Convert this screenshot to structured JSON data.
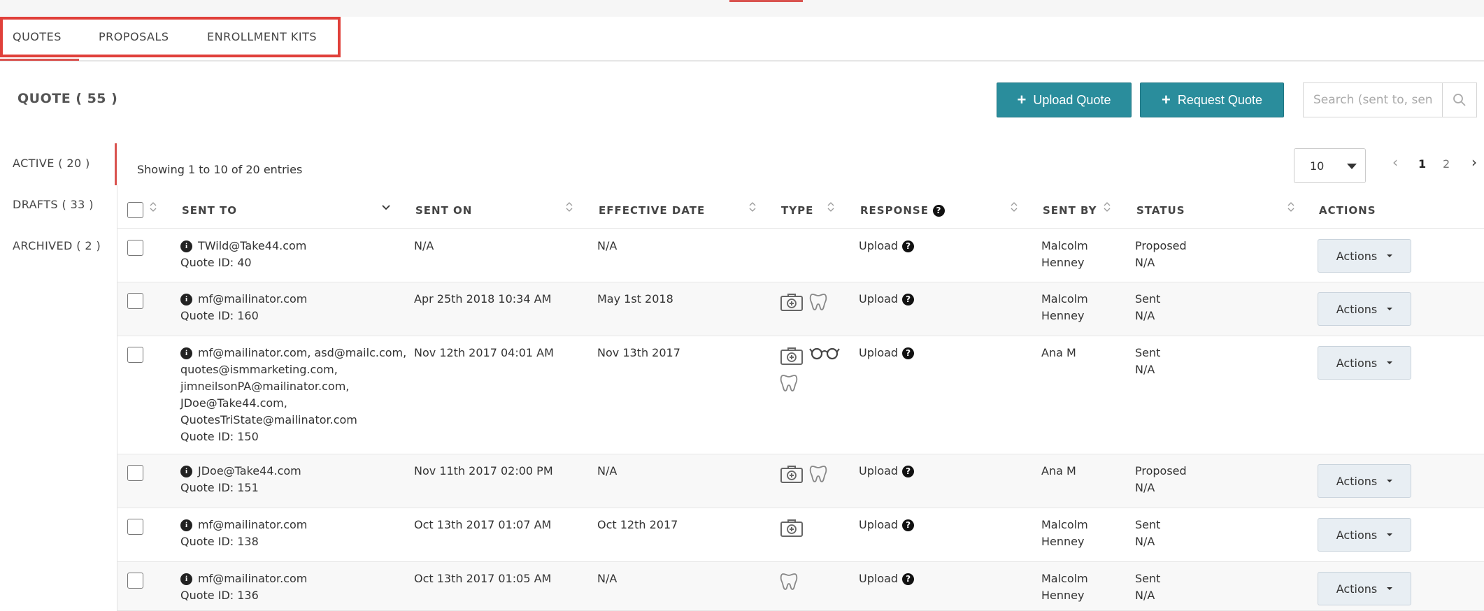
{
  "tabs": [
    "QUOTES",
    "PROPOSALS",
    "ENROLLMENT KITS"
  ],
  "page_title": "QUOTE ( 55 )",
  "buttons": {
    "upload_quote": "Upload Quote",
    "request_quote": "Request Quote"
  },
  "search": {
    "placeholder": "Search (sent to, sender...)"
  },
  "sidebar": {
    "items": [
      "ACTIVE ( 20 )",
      "DRAFTS ( 33 )",
      "ARCHIVED ( 2 )"
    ]
  },
  "showing": "Showing 1 to 10 of 20 entries",
  "page_size": "10",
  "pagination": {
    "prev": "‹",
    "pages": [
      "1",
      "2"
    ],
    "next": "›"
  },
  "columns": [
    "SENT TO",
    "SENT ON",
    "EFFECTIVE DATE",
    "TYPE",
    "RESPONSE",
    "SENT BY",
    "STATUS",
    "ACTIONS"
  ],
  "rows": [
    {
      "emails": [
        "TWild@Take44.com"
      ],
      "quote_id": "Quote ID: 40",
      "sent_on": "N/A",
      "effective": "N/A",
      "types": [],
      "response": "Upload",
      "sent_by": [
        "Malcolm",
        "Henney"
      ],
      "status": [
        "Proposed",
        "N/A"
      ],
      "action": "Actions"
    },
    {
      "emails": [
        "mf@mailinator.com"
      ],
      "quote_id": "Quote ID: 160",
      "sent_on": "Apr 25th 2018 10:34 AM",
      "effective": "May 1st 2018",
      "types": [
        "medical-icon",
        "dental-icon"
      ],
      "response": "Upload",
      "sent_by": [
        "Malcolm",
        "Henney"
      ],
      "status": [
        "Sent",
        "N/A"
      ],
      "action": "Actions"
    },
    {
      "emails": [
        "mf@mailinator.com, asd@mailc.com,",
        "quotes@ismmarketing.com,",
        "jimneilsonPA@mailinator.com,",
        "JDoe@Take44.com,",
        "QuotesTriState@mailinator.com"
      ],
      "quote_id": "Quote ID: 150",
      "sent_on": "Nov 12th 2017 04:01 AM",
      "effective": "Nov 13th 2017",
      "types": [
        "medical-icon",
        "vision-icon",
        "dental-icon"
      ],
      "response": "Upload",
      "sent_by": [
        "Ana M"
      ],
      "status": [
        "Sent",
        "N/A"
      ],
      "action": "Actions"
    },
    {
      "emails": [
        "JDoe@Take44.com"
      ],
      "quote_id": "Quote ID: 151",
      "sent_on": "Nov 11th 2017 02:00 PM",
      "effective": "N/A",
      "types": [
        "medical-icon",
        "dental-icon"
      ],
      "response": "Upload",
      "sent_by": [
        "Ana M"
      ],
      "status": [
        "Proposed",
        "N/A"
      ],
      "action": "Actions"
    },
    {
      "emails": [
        "mf@mailinator.com"
      ],
      "quote_id": "Quote ID: 138",
      "sent_on": "Oct 13th 2017 01:07 AM",
      "effective": "Oct 12th 2017",
      "types": [
        "medical-icon"
      ],
      "response": "Upload",
      "sent_by": [
        "Malcolm",
        "Henney"
      ],
      "status": [
        "Sent",
        "N/A"
      ],
      "action": "Actions"
    },
    {
      "emails": [
        "mf@mailinator.com"
      ],
      "quote_id": "Quote ID: 136",
      "sent_on": "Oct 13th 2017 01:05 AM",
      "effective": "N/A",
      "types": [
        "dental-icon"
      ],
      "response": "Upload",
      "sent_by": [
        "Malcolm",
        "Henney"
      ],
      "status": [
        "Sent",
        "N/A"
      ],
      "action": "Actions"
    }
  ]
}
